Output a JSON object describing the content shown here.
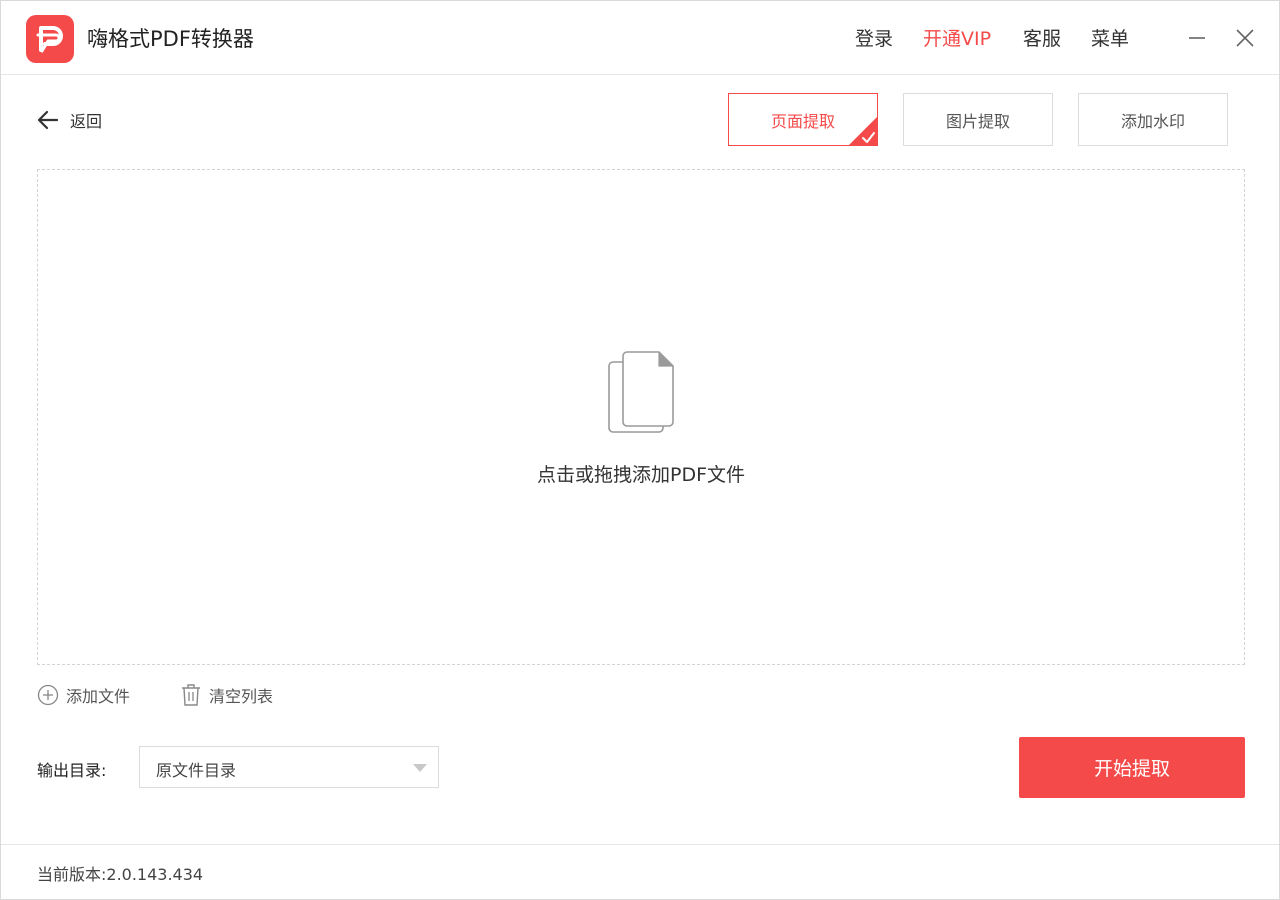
{
  "app": {
    "title": "嗨格式PDF转换器",
    "brand_color": "#f54a4a"
  },
  "header": {
    "login": "登录",
    "vip": "开通VIP",
    "service": "客服",
    "menu": "菜单",
    "minimize_icon": "minimize-icon",
    "close_icon": "close-icon"
  },
  "back": {
    "label": "返回",
    "icon": "arrow-left-icon"
  },
  "tabs": [
    {
      "label": "页面提取",
      "active": true
    },
    {
      "label": "图片提取",
      "active": false
    },
    {
      "label": "添加水印",
      "active": false
    }
  ],
  "dropzone": {
    "text": "点击或拖拽添加PDF文件",
    "icon": "document-stack-icon"
  },
  "actions": {
    "add_file": "添加文件",
    "clear_list": "清空列表"
  },
  "output": {
    "label": "输出目录:",
    "selected": "原文件目录"
  },
  "start_button": "开始提取",
  "footer": {
    "version": "当前版本:2.0.143.434"
  }
}
